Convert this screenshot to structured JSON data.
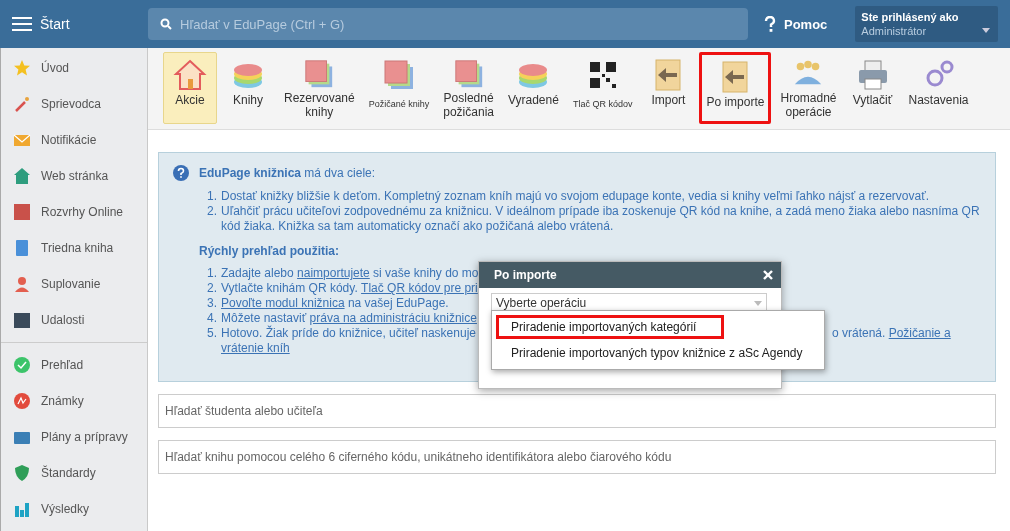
{
  "header": {
    "title": "Štart",
    "search": {
      "placeholder": "Hľadať v EduPage (Ctrl + G)"
    },
    "help": "Pomoc",
    "user": {
      "caption": "Ste prihlásený ako",
      "name": "Administrátor"
    }
  },
  "sidebar": {
    "groups": [
      [
        {
          "label": "Úvod"
        },
        {
          "label": "Sprievodca"
        },
        {
          "label": "Notifikácie"
        },
        {
          "label": "Web stránka"
        },
        {
          "label": "Rozvrhy Online"
        },
        {
          "label": "Triedna kniha"
        },
        {
          "label": "Suplovanie"
        },
        {
          "label": "Udalosti"
        }
      ],
      [
        {
          "label": "Prehľad"
        },
        {
          "label": "Známky"
        },
        {
          "label": "Plány a prípravy"
        },
        {
          "label": "Štandardy"
        },
        {
          "label": "Výsledky"
        }
      ]
    ]
  },
  "toolbar": [
    {
      "lines": [
        "Akcie"
      ],
      "selected": true,
      "highlighted": false,
      "small": false
    },
    {
      "lines": [
        "Knihy"
      ],
      "selected": false,
      "highlighted": false,
      "small": false
    },
    {
      "lines": [
        "Rezervované",
        "knihy"
      ],
      "selected": false,
      "highlighted": false,
      "small": false
    },
    {
      "lines": [
        "Požičané knihy"
      ],
      "selected": false,
      "highlighted": false,
      "small": true
    },
    {
      "lines": [
        "Posledné",
        "požičania"
      ],
      "selected": false,
      "highlighted": false,
      "small": false
    },
    {
      "lines": [
        "Vyradené"
      ],
      "selected": false,
      "highlighted": false,
      "small": false
    },
    {
      "lines": [
        "Tlač QR kódov"
      ],
      "selected": false,
      "highlighted": false,
      "small": true
    },
    {
      "lines": [
        "Import"
      ],
      "selected": false,
      "highlighted": false,
      "small": false
    },
    {
      "lines": [
        "Po importe"
      ],
      "selected": false,
      "highlighted": true,
      "small": false
    },
    {
      "lines": [
        "Hromadné",
        "operácie"
      ],
      "selected": false,
      "highlighted": false,
      "small": false
    },
    {
      "lines": [
        "Vytlačiť"
      ],
      "selected": false,
      "highlighted": false,
      "small": false
    },
    {
      "lines": [
        "Nastavenia"
      ],
      "selected": false,
      "highlighted": false,
      "small": false
    }
  ],
  "info": {
    "heading": "**EduPage knižnica** má dva ciele:",
    "goals": [
      {
        "number": "1.",
        "text": "Dostať knižky bližšie k deťom. Kompletný zoznam kníh majú vo svojom edupage konte, vedia si knihy veľmi ľahko nájsť a rezervovať."
      },
      {
        "number": "2.",
        "text": "Uľahčiť prácu učiteľovi zodpovednému za knižnicu. V ideálnom prípade iba zoskenuje QR kód na knihe, a zadá meno žiaka alebo nasníma QR kód žiaka. Knižka sa tam automaticky označí ako požičaná alebo vrátená."
      }
    ],
    "steps_heading": "Rýchly prehľad použitia:",
    "steps": [
      {
        "number": "1.",
        "segments": [
          {
            "text": "Zadajte alebo ",
            "link": false
          },
          {
            "text": "naimportujete",
            "link": true
          },
          {
            "text": " si vaše knihy do mo",
            "link": false
          }
        ]
      },
      {
        "number": "2.",
        "segments": [
          {
            "text": "Vytlačte knihám QR kódy. ",
            "link": false
          },
          {
            "text": "Tlač QR kódov pre pri",
            "link": true
          }
        ]
      },
      {
        "number": "3.",
        "segments": [
          {
            "text": "Povoľte modul knižnica",
            "link": true
          },
          {
            "text": " na vašej EduPage.",
            "link": false
          }
        ]
      },
      {
        "number": "4.",
        "segments": [
          {
            "text": "Môžete nastaviť ",
            "link": false
          },
          {
            "text": "práva na administráciu knižnice",
            "link": true
          }
        ]
      },
      {
        "number": "5.",
        "segments": [
          {
            "text": "Hotovo. Žiak príde do knižnice, učiteľ naskenuje",
            "link": false
          }
        ],
        "after_popup": [
          {
            "text": "o vrátená. ",
            "link": false
          },
          {
            "text": "Požičanie a",
            "link": true
          }
        ],
        "next_line": [
          {
            "text": "vrátenie kníh",
            "link": true
          }
        ]
      }
    ]
  },
  "search_fields": [
    {
      "placeholder": "Hľadať študenta alebo učiteľa"
    },
    {
      "placeholder": "Hľadať knihu pomocou celého 6 ciferného kódu, unikátneho identifikátora alebo čiarového kódu"
    }
  ],
  "dialog": {
    "title": "Po importe",
    "select": {
      "value": "Vyberte operáciu"
    },
    "options": [
      {
        "label": "Priradenie importovaných kategórií",
        "highlighted": true
      },
      {
        "label": "Priradenie importovaných typov knižnice z aSc Agendy",
        "highlighted": false
      }
    ]
  }
}
